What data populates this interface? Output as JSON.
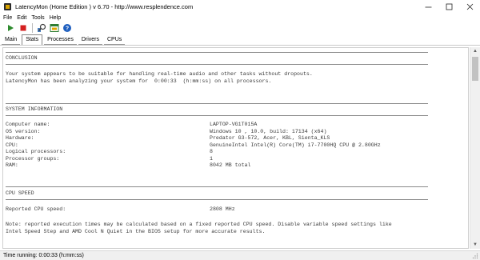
{
  "window": {
    "title": "LatencyMon  (Home Edition )  v 6.70 - http://www.resplendence.com",
    "controls": [
      "minimize",
      "maximize",
      "close"
    ]
  },
  "menu": [
    "File",
    "Edit",
    "Tools",
    "Help"
  ],
  "toolbar": {
    "buttons": [
      "play-icon",
      "stop-icon",
      "analyze-icon",
      "window-icon",
      "help-icon"
    ]
  },
  "tabs": [
    {
      "label": "Main",
      "active": false
    },
    {
      "label": "Stats",
      "active": true
    },
    {
      "label": "Processes",
      "active": false
    },
    {
      "label": "Drivers",
      "active": false
    },
    {
      "label": "CPUs",
      "active": false
    }
  ],
  "report": {
    "conclusion": {
      "header": "CONCLUSION",
      "line1": "Your system appears to be suitable for handling real-time audio and other tasks without dropouts.",
      "line2": "LatencyMon has been analyzing your system for  0:00:33  (h:mm:ss) on all processors."
    },
    "system_info": {
      "header": "SYSTEM INFORMATION",
      "rows": [
        {
          "key": "Computer name:",
          "value": "LAPTOP-VG1T015A"
        },
        {
          "key": "OS version:",
          "value": "Windows 10 , 10.0, build: 17134 (x64)"
        },
        {
          "key": "Hardware:",
          "value": "Predator G3-572, Acer, KBL, Sienta_KLS"
        },
        {
          "key": "CPU:",
          "value": "GenuineIntel Intel(R) Core(TM) i7-7700HQ CPU @ 2.80GHz"
        },
        {
          "key": "Logical processors:",
          "value": "8"
        },
        {
          "key": "Processor groups:",
          "value": "1"
        },
        {
          "key": "RAM:",
          "value": "8042 MB total"
        }
      ]
    },
    "cpu_speed": {
      "header": "CPU SPEED",
      "row": {
        "key": "Reported CPU speed:",
        "value": "2808 MHz"
      },
      "note1": "Note: reported execution times may be calculated based on a fixed reported CPU speed. Disable variable speed settings like",
      "note2": "Intel Speed Step and AMD Cool N Quiet in the BIOS setup for more accurate results."
    }
  },
  "status": {
    "text": "Time running: 0:00:33  (h:mm:ss)"
  },
  "colors": {
    "play": "#2e8b2e",
    "stop": "#d42020",
    "help": "#1f5fbf"
  }
}
